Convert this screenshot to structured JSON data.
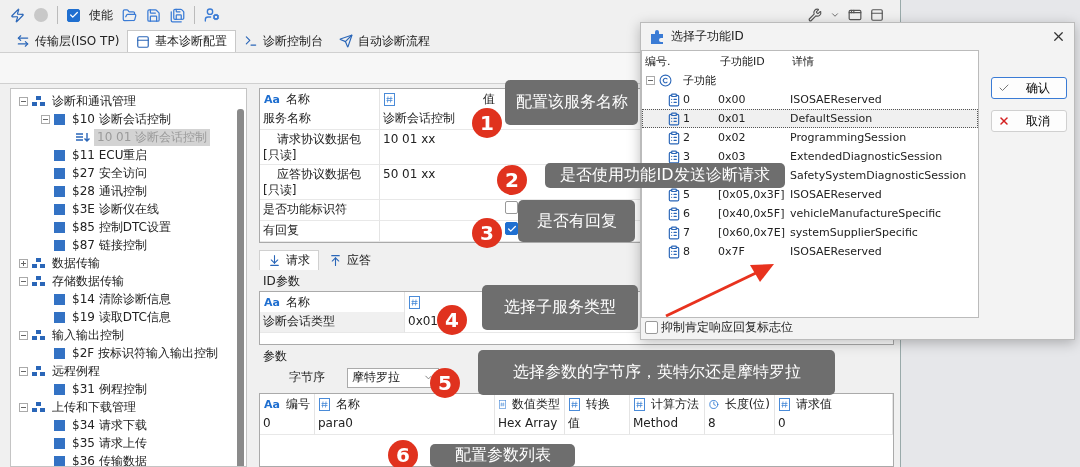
{
  "toolbar": {
    "enable": {
      "label": "使能",
      "checked": true
    }
  },
  "tabs": [
    {
      "label": "传输层(ISO TP)",
      "selected": false
    },
    {
      "label": "基本诊断配置",
      "selected": true
    },
    {
      "label": "诊断控制台",
      "selected": false
    },
    {
      "label": "自动诊断流程",
      "selected": false
    }
  ],
  "tree": [
    {
      "kind": "group",
      "label": "诊断和通讯管理",
      "expanded": true,
      "selected": false,
      "children": [
        {
          "kind": "service",
          "label": "$10 诊断会话控制",
          "expanded": true,
          "selected": false,
          "children": [
            {
              "kind": "subfunction",
              "label": "10 01 诊断会话控制",
              "selected": true
            }
          ]
        },
        {
          "kind": "service",
          "label": "$11 ECU重启",
          "selected": false
        },
        {
          "kind": "service",
          "label": "$27 安全访问",
          "selected": false
        },
        {
          "kind": "service",
          "label": "$28 通讯控制",
          "selected": false
        },
        {
          "kind": "service",
          "label": "$3E 诊断仪在线",
          "selected": false
        },
        {
          "kind": "service",
          "label": "$85 控制DTC设置",
          "selected": false
        },
        {
          "kind": "service",
          "label": "$87 链接控制",
          "selected": false
        }
      ]
    },
    {
      "kind": "group",
      "label": "数据传输",
      "expanded": false,
      "selected": false
    },
    {
      "kind": "group",
      "label": "存储数据传输",
      "expanded": true,
      "selected": false,
      "children": [
        {
          "kind": "service",
          "label": "$14 清除诊断信息",
          "selected": false
        },
        {
          "kind": "service",
          "label": "$19 读取DTC信息",
          "selected": false
        }
      ]
    },
    {
      "kind": "group",
      "label": "输入输出控制",
      "expanded": true,
      "selected": false,
      "children": [
        {
          "kind": "service",
          "label": "$2F 按标识符输入输出控制",
          "selected": false
        }
      ]
    },
    {
      "kind": "group",
      "label": "远程例程",
      "expanded": true,
      "selected": false,
      "children": [
        {
          "kind": "service",
          "label": "$31 例程控制",
          "selected": false
        }
      ]
    },
    {
      "kind": "group",
      "label": "上传和下载管理",
      "expanded": true,
      "selected": false,
      "children": [
        {
          "kind": "service",
          "label": "$34 请求下载",
          "selected": false
        },
        {
          "kind": "service",
          "label": "$35 请求上传",
          "selected": false
        },
        {
          "kind": "service",
          "label": "$36 传输数据",
          "selected": false
        }
      ]
    }
  ],
  "properties": {
    "columns": [
      {
        "kind": "text",
        "type_label": "Aa",
        "label": "名称"
      },
      {
        "kind": "number",
        "label": "值"
      }
    ],
    "rows": [
      {
        "kind": "text",
        "name": "服务名称",
        "value": "诊断会话控制"
      },
      {
        "kind": "readonly",
        "name": "请求协议数据包[只读]",
        "value": "10 01 xx"
      },
      {
        "kind": "readonly",
        "name": "应答协议数据包[只读]",
        "value": "50 01 xx"
      },
      {
        "kind": "checkbox",
        "name": "是否功能标识符",
        "checked": false
      },
      {
        "kind": "checkbox",
        "name": "有回复",
        "checked": true
      }
    ]
  },
  "message_tabs": [
    {
      "label": "请求",
      "selected": true
    },
    {
      "label": "应答",
      "selected": false
    }
  ],
  "id_params": {
    "title": "ID参数",
    "columns": [
      {
        "kind": "text",
        "type_label": "Aa",
        "label": "名称"
      },
      {
        "kind": "number"
      }
    ],
    "rows": [
      {
        "name": "诊断会话类型",
        "value": "0x01"
      }
    ]
  },
  "params": {
    "title": "参数",
    "byte_order": {
      "label": "字节序",
      "value": "摩特罗拉"
    },
    "columns": [
      {
        "kind": "text",
        "type_label": "Aa",
        "label": "编号"
      },
      {
        "kind": "number",
        "label": "名称"
      },
      {
        "kind": "number",
        "label": "数值类型"
      },
      {
        "kind": "number",
        "label": "转换"
      },
      {
        "kind": "number",
        "label": "计算方法"
      },
      {
        "kind": "clock",
        "label": "长度(位)"
      },
      {
        "kind": "number",
        "label": "请求值"
      }
    ],
    "rows": [
      [
        "0",
        "para0",
        "Hex Array",
        "值",
        "Method",
        "8",
        "0"
      ]
    ]
  },
  "dialog": {
    "title": "选择子功能ID",
    "columns": [
      "编号.",
      "子功能ID",
      "详情"
    ],
    "root": {
      "label": "子功能",
      "expanded": true
    },
    "items": [
      {
        "number": "0",
        "id": "0x00",
        "detail": "ISOSAEReserved",
        "selected": false
      },
      {
        "number": "1",
        "id": "0x01",
        "detail": "DefaultSession",
        "selected": true
      },
      {
        "number": "2",
        "id": "0x02",
        "detail": "ProgrammingSession",
        "selected": false
      },
      {
        "number": "3",
        "id": "0x03",
        "detail": "ExtendedDiagnosticSession",
        "selected": false
      },
      {
        "detail": "SafetySystemDiagnosticSession",
        "selected": false
      },
      {
        "number": "5",
        "id": "[0x05,0x3F]",
        "detail": "ISOSAEReserved",
        "selected": false
      },
      {
        "number": "6",
        "id": "[0x40,0x5F]",
        "detail": "vehicleManufactureSpecific",
        "selected": false
      },
      {
        "number": "7",
        "id": "[0x60,0x7E]",
        "detail": "systemSupplierSpecific",
        "selected": false
      },
      {
        "number": "8",
        "id": "0x7F",
        "detail": "ISOSAEReserved",
        "selected": false
      }
    ],
    "buttons": [
      {
        "kind": "ok",
        "label": "确认"
      },
      {
        "kind": "cancel",
        "label": "取消"
      }
    ],
    "suppress": {
      "label": "抑制肯定响应回复标志位",
      "checked": false
    }
  },
  "annotations": [
    {
      "number": "1",
      "text": "配置该服务名称"
    },
    {
      "number": "2",
      "text": "是否使用功能ID发送诊断请求"
    },
    {
      "number": "3",
      "text": "是否有回复"
    },
    {
      "number": "4",
      "text": "选择子服务类型"
    },
    {
      "number": "5",
      "text": "选择参数的字节序，英特尔还是摩特罗拉"
    },
    {
      "number": "6",
      "text": "配置参数列表"
    }
  ]
}
